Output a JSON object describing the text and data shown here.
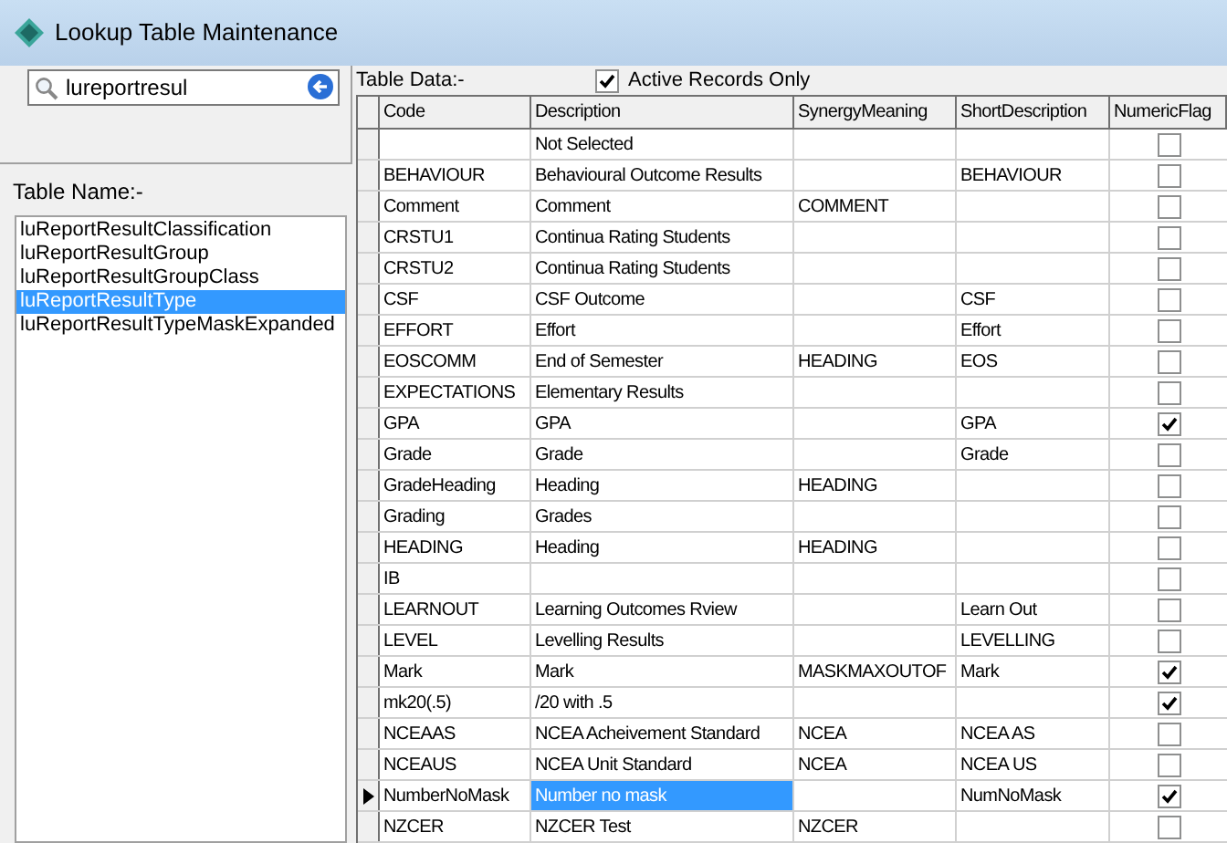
{
  "window": {
    "title": "Lookup Table Maintenance"
  },
  "search": {
    "value": "lureportresul"
  },
  "table_name_label": "Table Name:-",
  "table_list": [
    {
      "label": "luReportResultClassification",
      "selected": false
    },
    {
      "label": "luReportResultGroup",
      "selected": false
    },
    {
      "label": "luReportResultGroupClass",
      "selected": false
    },
    {
      "label": "luReportResultType",
      "selected": true
    },
    {
      "label": "luReportResultTypeMaskExpanded",
      "selected": false
    }
  ],
  "table_data_label": "Table Data:-",
  "active_records_only": {
    "label": "Active Records Only",
    "checked": true
  },
  "grid": {
    "columns": [
      "Code",
      "Description",
      "SynergyMeaning",
      "ShortDescription",
      "NumericFlag"
    ],
    "rows": [
      {
        "code": "",
        "description": "Not Selected",
        "synergy": "",
        "short": "",
        "numeric": false,
        "selected": false
      },
      {
        "code": "BEHAVIOUR",
        "description": "Behavioural Outcome Results",
        "synergy": "",
        "short": "BEHAVIOUR",
        "numeric": false,
        "selected": false
      },
      {
        "code": "Comment",
        "description": "Comment",
        "synergy": "COMMENT",
        "short": "",
        "numeric": false,
        "selected": false
      },
      {
        "code": "CRSTU1",
        "description": "Continua Rating Students",
        "synergy": "",
        "short": "",
        "numeric": false,
        "selected": false
      },
      {
        "code": "CRSTU2",
        "description": "Continua Rating Students",
        "synergy": "",
        "short": "",
        "numeric": false,
        "selected": false
      },
      {
        "code": "CSF",
        "description": "CSF Outcome",
        "synergy": "",
        "short": "CSF",
        "numeric": false,
        "selected": false
      },
      {
        "code": "EFFORT",
        "description": "Effort",
        "synergy": "",
        "short": "Effort",
        "numeric": false,
        "selected": false
      },
      {
        "code": "EOSCOMM",
        "description": "End of Semester",
        "synergy": "HEADING",
        "short": "EOS",
        "numeric": false,
        "selected": false
      },
      {
        "code": "EXPECTATIONS",
        "description": "Elementary Results",
        "synergy": "",
        "short": "",
        "numeric": false,
        "selected": false
      },
      {
        "code": "GPA",
        "description": "GPA",
        "synergy": "",
        "short": "GPA",
        "numeric": true,
        "selected": false
      },
      {
        "code": "Grade",
        "description": "Grade",
        "synergy": "",
        "short": "Grade",
        "numeric": false,
        "selected": false
      },
      {
        "code": "GradeHeading",
        "description": "Heading",
        "synergy": "HEADING",
        "short": "",
        "numeric": false,
        "selected": false
      },
      {
        "code": "Grading",
        "description": "Grades",
        "synergy": "",
        "short": "",
        "numeric": false,
        "selected": false
      },
      {
        "code": "HEADING",
        "description": "Heading",
        "synergy": "HEADING",
        "short": "",
        "numeric": false,
        "selected": false
      },
      {
        "code": "IB",
        "description": "",
        "synergy": "",
        "short": "",
        "numeric": false,
        "selected": false
      },
      {
        "code": "LEARNOUT",
        "description": "Learning Outcomes Rview",
        "synergy": "",
        "short": "Learn Out",
        "numeric": false,
        "selected": false
      },
      {
        "code": "LEVEL",
        "description": "Levelling Results",
        "synergy": "",
        "short": "LEVELLING",
        "numeric": false,
        "selected": false
      },
      {
        "code": "Mark",
        "description": "Mark",
        "synergy": "MASKMAXOUTOF",
        "short": "Mark",
        "numeric": true,
        "selected": false
      },
      {
        "code": "mk20(.5)",
        "description": "/20 with .5",
        "synergy": "",
        "short": "",
        "numeric": true,
        "selected": false
      },
      {
        "code": "NCEAAS",
        "description": "NCEA Acheivement Standard",
        "synergy": "NCEA",
        "short": "NCEA AS",
        "numeric": false,
        "selected": false
      },
      {
        "code": "NCEAUS",
        "description": "NCEA Unit Standard",
        "synergy": "NCEA",
        "short": "NCEA US",
        "numeric": false,
        "selected": false
      },
      {
        "code": "NumberNoMask",
        "description": "Number no mask",
        "synergy": "",
        "short": "NumNoMask",
        "numeric": true,
        "selected": true
      },
      {
        "code": "NZCER",
        "description": "NZCER Test",
        "synergy": "NZCER",
        "short": "",
        "numeric": false,
        "selected": false
      }
    ]
  }
}
